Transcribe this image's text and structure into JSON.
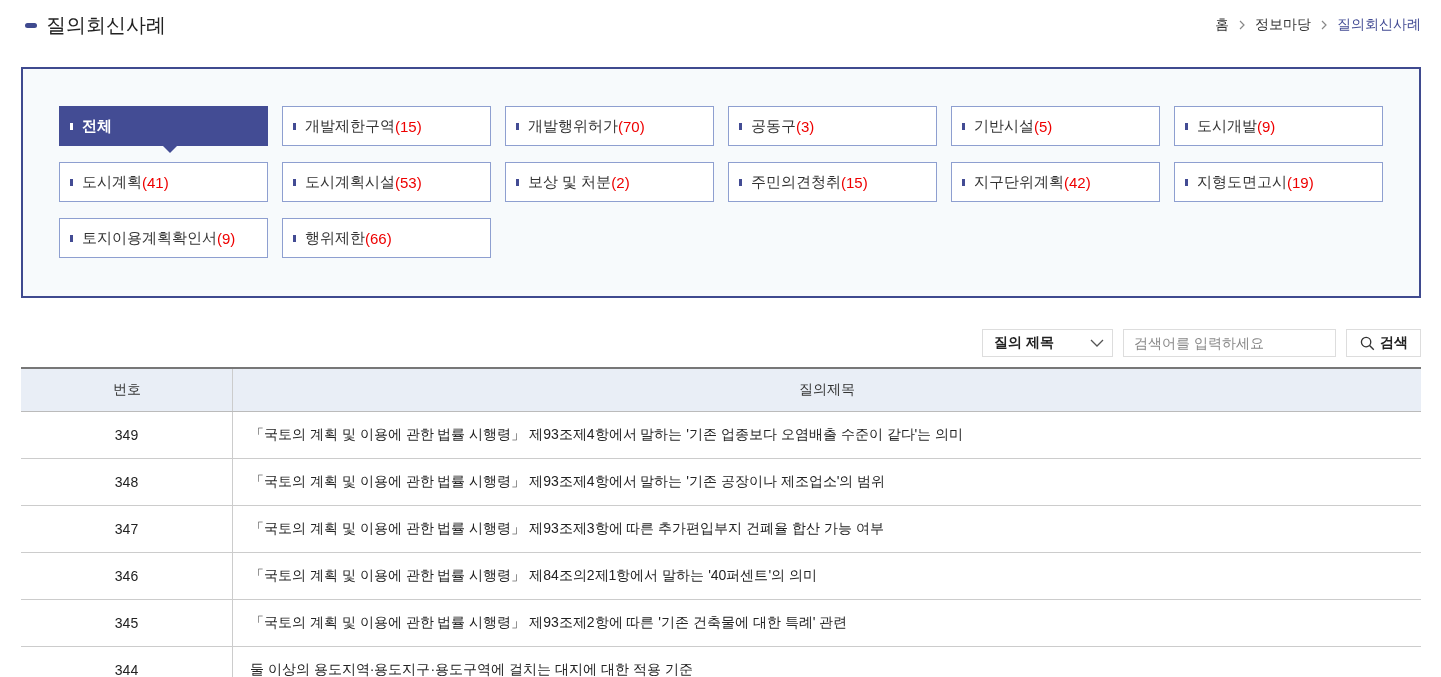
{
  "page_title": "질의회신사례",
  "breadcrumb": [
    {
      "label": "홈",
      "current": false
    },
    {
      "label": "정보마당",
      "current": false
    },
    {
      "label": "질의회신사례",
      "current": true
    }
  ],
  "categories": [
    {
      "label": "전체",
      "selected": true
    },
    {
      "label": "개발제한구역",
      "count": "(15)",
      "selected": false
    },
    {
      "label": "개발행위허가",
      "count": "(70)",
      "selected": false
    },
    {
      "label": "공동구",
      "count": "(3)",
      "selected": false
    },
    {
      "label": "기반시설",
      "count": "(5)",
      "selected": false
    },
    {
      "label": "도시개발",
      "count": "(9)",
      "selected": false
    },
    {
      "label": "도시계획",
      "count": "(41)",
      "selected": false
    },
    {
      "label": "도시계획시설",
      "count": "(53)",
      "selected": false
    },
    {
      "label": "보상 및 처분",
      "count": "(2)",
      "selected": false
    },
    {
      "label": "주민의견청취",
      "count": "(15)",
      "selected": false
    },
    {
      "label": "지구단위계획",
      "count": "(42)",
      "selected": false
    },
    {
      "label": "지형도면고시",
      "count": "(19)",
      "selected": false
    },
    {
      "label": "토지이용계획확인서",
      "count": "(9)",
      "selected": false
    },
    {
      "label": "행위제한",
      "count": "(66)",
      "selected": false
    }
  ],
  "search": {
    "field_select": "질의 제목",
    "placeholder": "검색어를 입력하세요",
    "button": "검색"
  },
  "table": {
    "columns": [
      "번호",
      "질의제목"
    ],
    "rows": [
      {
        "number": "349",
        "title": "「국토의 계획 및 이용에 관한 법률 시행령」 제93조제4항에서 말하는 '기존 업종보다 오염배출 수준이 같다'는 의미"
      },
      {
        "number": "348",
        "title": "「국토의 계획 및 이용에 관한 법률 시행령」 제93조제4항에서 말하는 '기존 공장이나 제조업소'의 범위"
      },
      {
        "number": "347",
        "title": "「국토의 계획 및 이용에 관한 법률 시행령」 제93조제3항에 따른 추가편입부지 건폐율 합산 가능 여부"
      },
      {
        "number": "346",
        "title": "「국토의 계획 및 이용에 관한 법률 시행령」 제84조의2제1항에서 말하는 '40퍼센트'의 의미"
      },
      {
        "number": "345",
        "title": "「국토의 계획 및 이용에 관한 법률 시행령」 제93조제2항에 따른 '기존 건축물에 대한 특례' 관련"
      },
      {
        "number": "344",
        "title": "둘 이상의 용도지역·용도지구·용도구역에 걸치는 대지에 대한 적용 기준"
      }
    ]
  }
}
